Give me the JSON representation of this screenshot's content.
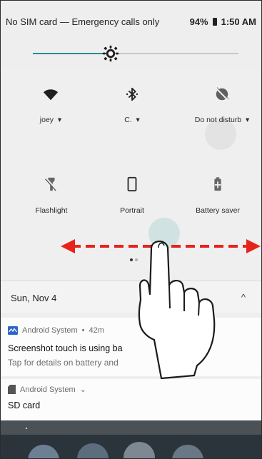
{
  "status_bar": {
    "carrier_text": "No SIM card — Emergency calls only",
    "battery_percent": "94%",
    "time": "1:50 AM"
  },
  "brightness": {
    "level": 0.38
  },
  "quick_settings": {
    "tiles": [
      {
        "label": "joey",
        "icon": "wifi-icon",
        "has_dropdown": true
      },
      {
        "label": "C.",
        "icon": "bluetooth-icon",
        "has_dropdown": true
      },
      {
        "label": "Do not disturb",
        "icon": "do-not-disturb-icon",
        "has_dropdown": true
      },
      {
        "label": "Flashlight",
        "icon": "flashlight-icon",
        "has_dropdown": false
      },
      {
        "label": "Portrait",
        "icon": "portrait-icon",
        "has_dropdown": false
      },
      {
        "label": "Battery saver",
        "icon": "battery-saver-icon",
        "has_dropdown": false
      }
    ],
    "dropdown_glyph": "▾",
    "page_count": 2,
    "current_page": 1
  },
  "date_row": {
    "date": "Sun, Nov 4",
    "caret": "^"
  },
  "notifications": [
    {
      "app": "Android System",
      "time": "42m",
      "separator": "•",
      "title": "Screenshot touch is using ba",
      "body": "Tap for details on battery and"
    },
    {
      "app": "Android System",
      "expand_glyph": "⌄",
      "title": "SD card"
    }
  ],
  "gesture_overlay": {
    "gesture": "swipe-horizontal",
    "arrow_color": "#e8231c"
  },
  "colors": {
    "accent": "#2a8c95",
    "panel": "#efefef",
    "dark": "#2c343b"
  }
}
